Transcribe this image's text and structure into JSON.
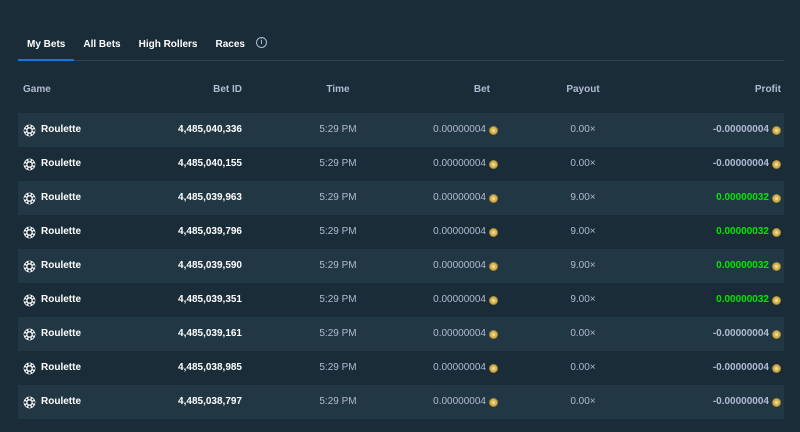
{
  "tabs": [
    {
      "label": "My Bets",
      "active": true
    },
    {
      "label": "All Bets",
      "active": false
    },
    {
      "label": "High Rollers",
      "active": false
    },
    {
      "label": "Races",
      "active": false
    }
  ],
  "info_icon": "info-icon",
  "columns": {
    "game": "Game",
    "bet_id": "Bet ID",
    "time": "Time",
    "bet": "Bet",
    "payout": "Payout",
    "profit": "Profit"
  },
  "rows": [
    {
      "game": "Roulette",
      "bet_id": "4,485,040,336",
      "time": "5:29 PM",
      "bet": "0.00000004",
      "payout": "0.00×",
      "profit": "-0.00000004",
      "win": false
    },
    {
      "game": "Roulette",
      "bet_id": "4,485,040,155",
      "time": "5:29 PM",
      "bet": "0.00000004",
      "payout": "0.00×",
      "profit": "-0.00000004",
      "win": false
    },
    {
      "game": "Roulette",
      "bet_id": "4,485,039,963",
      "time": "5:29 PM",
      "bet": "0.00000004",
      "payout": "9.00×",
      "profit": "0.00000032",
      "win": true
    },
    {
      "game": "Roulette",
      "bet_id": "4,485,039,796",
      "time": "5:29 PM",
      "bet": "0.00000004",
      "payout": "9.00×",
      "profit": "0.00000032",
      "win": true
    },
    {
      "game": "Roulette",
      "bet_id": "4,485,039,590",
      "time": "5:29 PM",
      "bet": "0.00000004",
      "payout": "9.00×",
      "profit": "0.00000032",
      "win": true
    },
    {
      "game": "Roulette",
      "bet_id": "4,485,039,351",
      "time": "5:29 PM",
      "bet": "0.00000004",
      "payout": "9.00×",
      "profit": "0.00000032",
      "win": true
    },
    {
      "game": "Roulette",
      "bet_id": "4,485,039,161",
      "time": "5:29 PM",
      "bet": "0.00000004",
      "payout": "0.00×",
      "profit": "-0.00000004",
      "win": false
    },
    {
      "game": "Roulette",
      "bet_id": "4,485,038,985",
      "time": "5:29 PM",
      "bet": "0.00000004",
      "payout": "0.00×",
      "profit": "-0.00000004",
      "win": false
    },
    {
      "game": "Roulette",
      "bet_id": "4,485,038,797",
      "time": "5:29 PM",
      "bet": "0.00000004",
      "payout": "0.00×",
      "profit": "-0.00000004",
      "win": false
    }
  ],
  "colors": {
    "background": "#1a2c38",
    "row_alt": "#213743",
    "active_tab": "#1475e1",
    "win": "#00e701",
    "coin": "#d7b55a"
  }
}
